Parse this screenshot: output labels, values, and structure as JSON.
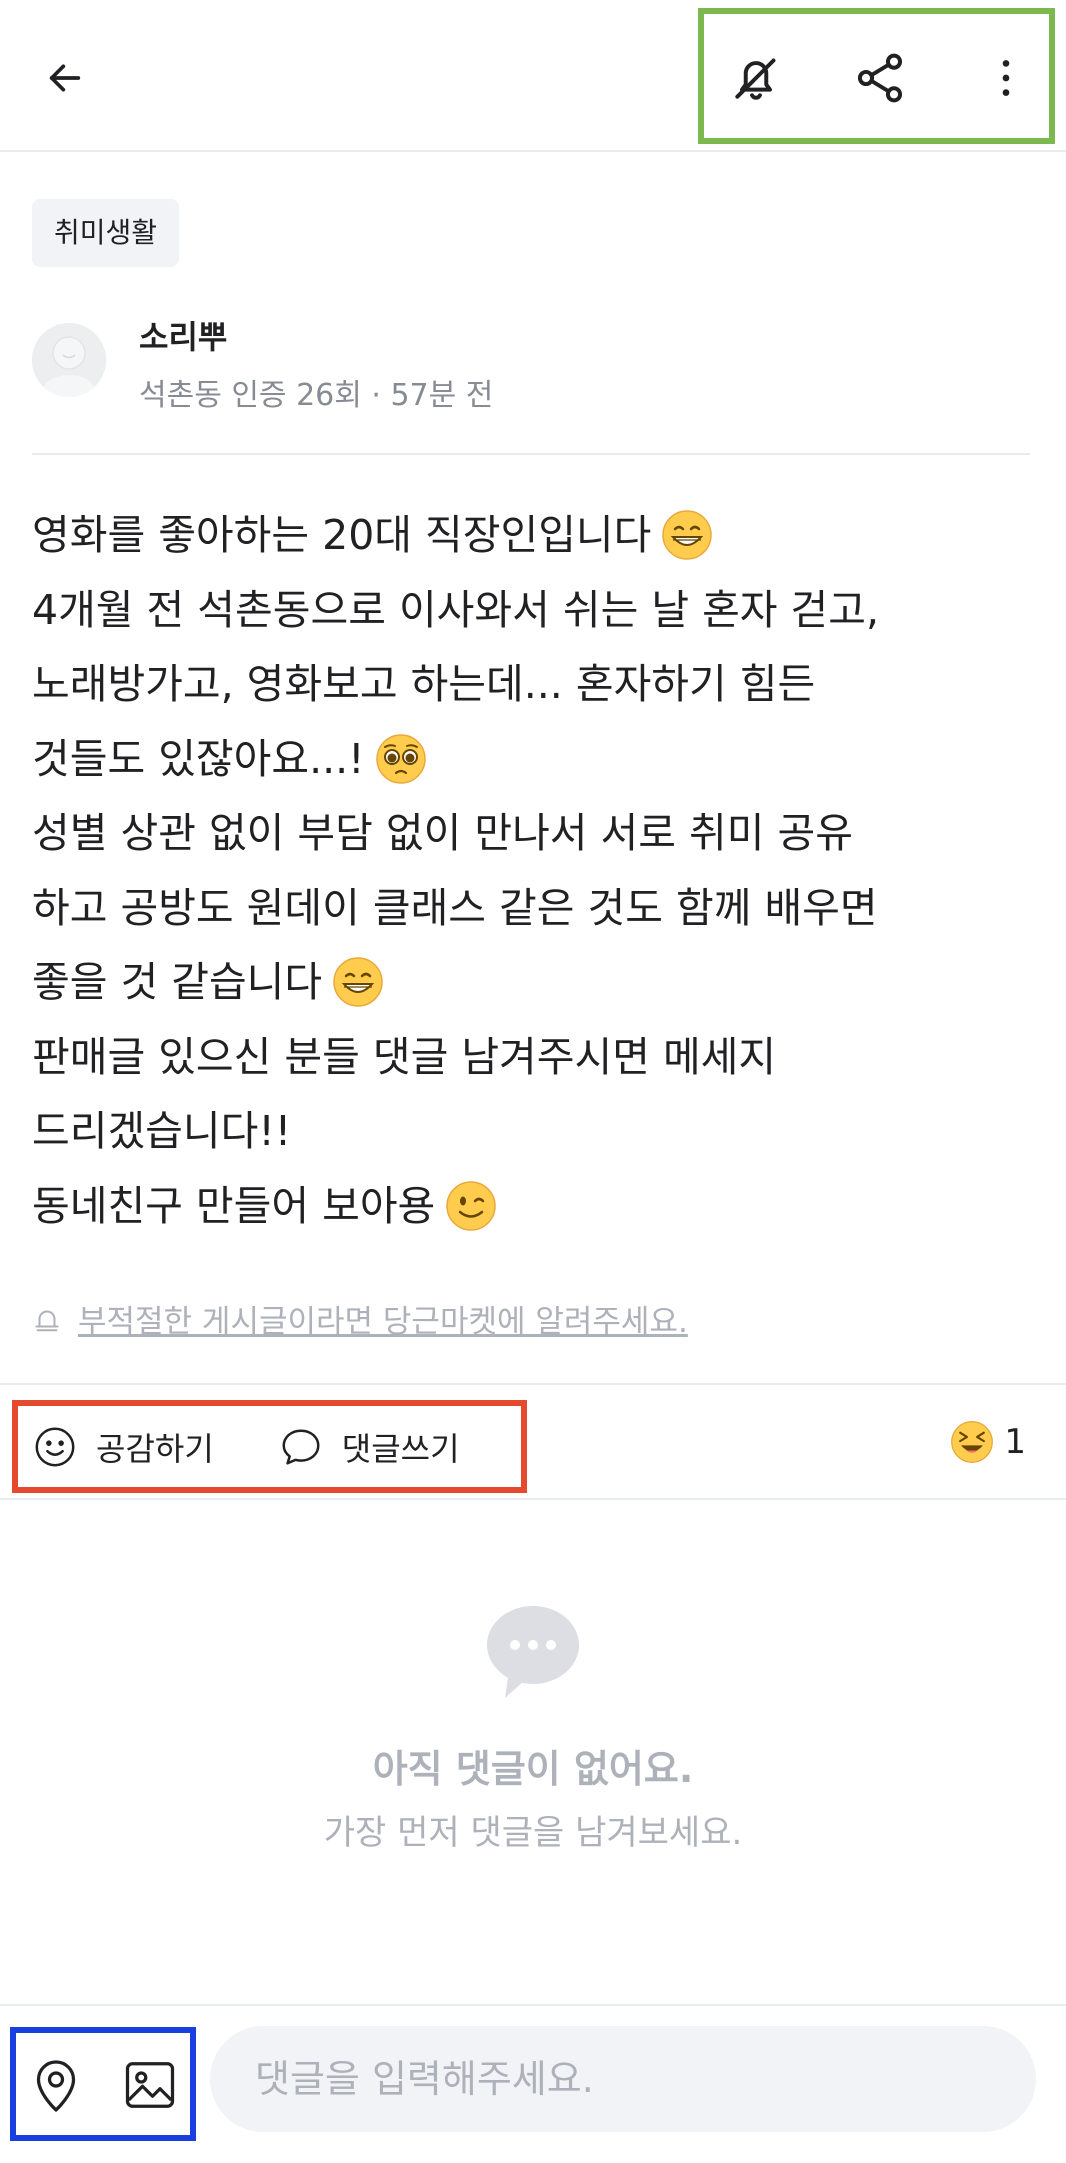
{
  "header": {
    "back_icon": "arrow-left-icon",
    "icons": [
      "bell-off-icon",
      "share-icon",
      "more-vertical-icon"
    ]
  },
  "post": {
    "category": "취미생활",
    "author": {
      "name": "소리뿌",
      "meta": "석촌동 인증 26회 · 57분 전"
    },
    "lines": [
      {
        "text": "영화를 좋아하는 20대 직장인입니다",
        "emoji": "grinning-face"
      },
      {
        "text": "4개월 전 석촌동으로 이사와서 쉬는 날 혼자 걷고,",
        "emoji": null
      },
      {
        "text": "노래방가고, 영화보고 하는데... 혼자하기 힘든",
        "emoji": null
      },
      {
        "text": "것들도 있잖아요...!",
        "emoji": "pleading-face"
      },
      {
        "text": "성별 상관 없이 부담 없이 만나서 서로 취미 공유",
        "emoji": null
      },
      {
        "text": "하고 공방도 원데이 클래스 같은 것도 함께 배우면",
        "emoji": null
      },
      {
        "text": "좋을 것 같습니다",
        "emoji": "grinning-face"
      },
      {
        "text": "판매글 있으신 분들 댓글 남겨주시면 메세지",
        "emoji": null
      },
      {
        "text": "드리겠습니다!!",
        "emoji": null
      },
      {
        "text": "동네친구 만들어 보아용",
        "emoji": "winking-face"
      }
    ],
    "report_text": "부적절한 게시글이라면 당근마켓에 알려주세요."
  },
  "actions": {
    "like_label": "공감하기",
    "comment_label": "댓글쓰기",
    "reaction_count": "1"
  },
  "comments": {
    "empty_title": "아직 댓글이 없어요.",
    "empty_subtitle": "가장 먼저 댓글을 남겨보세요."
  },
  "composer": {
    "placeholder": "댓글을 입력해주세요.",
    "icons": [
      "location-pin-icon",
      "image-icon"
    ]
  },
  "colors": {
    "highlight_green": "#7bb94f",
    "highlight_red": "#e54a2e",
    "highlight_blue": "#1a3fe0",
    "muted_text": "#868b94",
    "placeholder_text": "#adb1ba"
  }
}
